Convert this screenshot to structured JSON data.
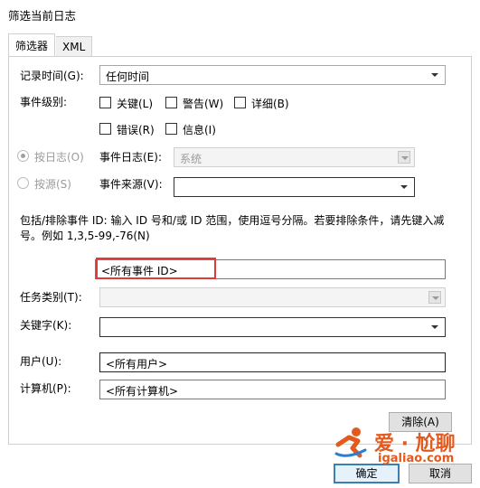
{
  "window": {
    "title": "筛选当前日志"
  },
  "tabs": [
    {
      "label": "筛选器",
      "active": true
    },
    {
      "label": "XML",
      "active": false
    }
  ],
  "logged": {
    "label": "记录时间(G):",
    "value": "任何时间"
  },
  "level": {
    "label": "事件级别:",
    "options": [
      {
        "label": "关键(L)",
        "checked": false
      },
      {
        "label": "警告(W)",
        "checked": false
      },
      {
        "label": "详细(B)",
        "checked": false
      },
      {
        "label": "错误(R)",
        "checked": false
      },
      {
        "label": "信息(I)",
        "checked": false
      }
    ]
  },
  "by_log": {
    "radio_label": "按日志(O)",
    "field_label": "事件日志(E):",
    "value": "系统"
  },
  "by_source": {
    "radio_label": "按源(S)",
    "field_label": "事件来源(V):",
    "value": ""
  },
  "event_ids": {
    "description": "包括/排除事件 ID: 输入 ID 号和/或 ID 范围，使用逗号分隔。若要排除条件，请先键入减号。例如 1,3,5-99,-76(N)",
    "value": "<所有事件 ID>"
  },
  "task_category": {
    "label": "任务类别(T):",
    "value": ""
  },
  "keywords": {
    "label": "关键字(K):",
    "value": ""
  },
  "user": {
    "label": "用户(U):",
    "value": "<所有用户>"
  },
  "computer": {
    "label": "计算机(P):",
    "value": "<所有计算机>"
  },
  "buttons": {
    "clear": "清除(A)",
    "ok": "确定",
    "cancel": "取消"
  },
  "watermark": {
    "text": "爱 · 尬聊",
    "url": "igaliao.com"
  },
  "colors": {
    "highlight": "#e03b3b",
    "watermark": "#e35a1e",
    "default_button": "#3c7fb1"
  }
}
